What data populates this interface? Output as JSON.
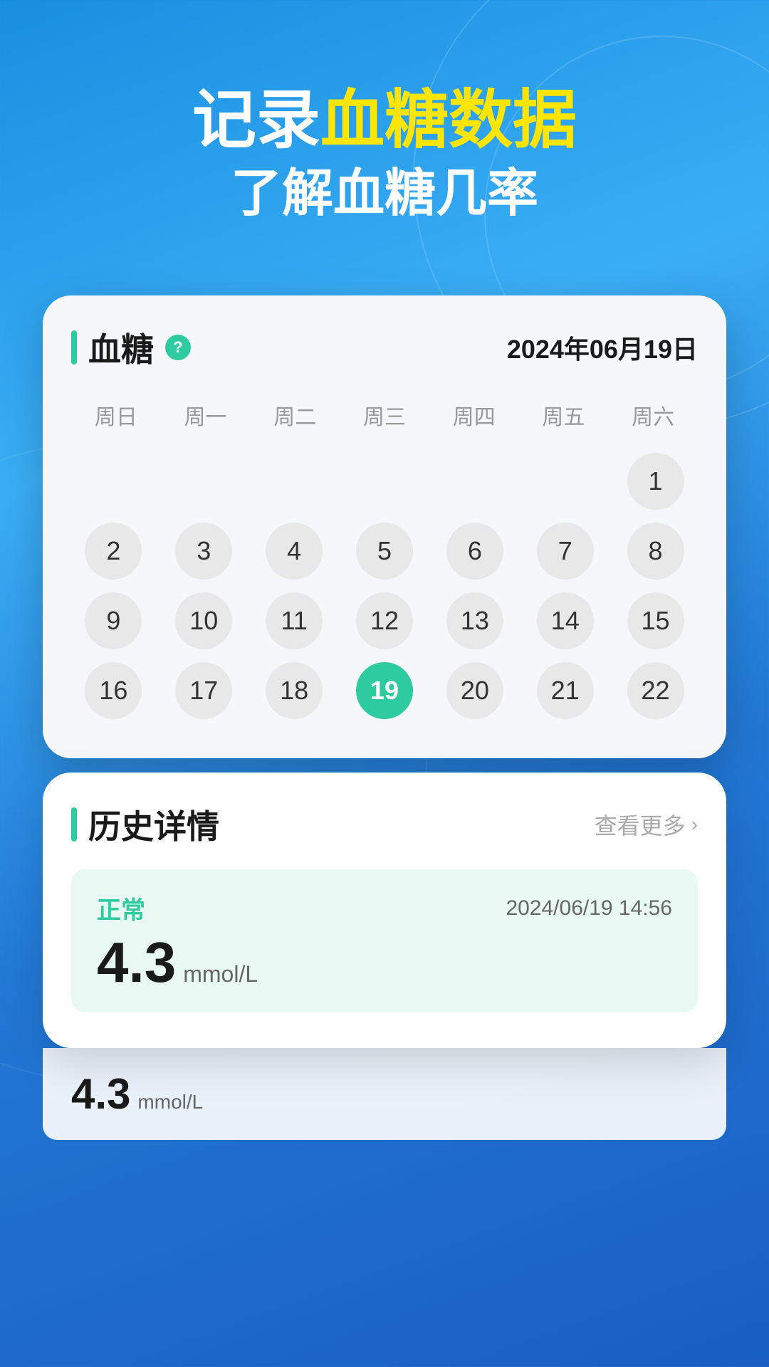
{
  "header": {
    "line1_prefix": "记录",
    "line1_highlight": "血糖数据",
    "line2": "了解血糖几率"
  },
  "calendar_card": {
    "title": "血糖",
    "date": "2024年06月19日",
    "help_icon": "?",
    "weekdays": [
      "周日",
      "周一",
      "周二",
      "周三",
      "周四",
      "周五",
      "周六"
    ],
    "days": [
      {
        "num": "",
        "empty": true
      },
      {
        "num": "",
        "empty": true
      },
      {
        "num": "",
        "empty": true
      },
      {
        "num": "",
        "empty": true
      },
      {
        "num": "",
        "empty": true
      },
      {
        "num": "",
        "empty": true
      },
      {
        "num": "1",
        "circle": true,
        "active": false
      },
      {
        "num": "2",
        "circle": true,
        "active": false
      },
      {
        "num": "3",
        "circle": true,
        "active": false
      },
      {
        "num": "4",
        "circle": true,
        "active": false
      },
      {
        "num": "5",
        "circle": true,
        "active": false
      },
      {
        "num": "6",
        "circle": true,
        "active": false
      },
      {
        "num": "7",
        "circle": true,
        "active": false
      },
      {
        "num": "8",
        "circle": true,
        "active": false
      },
      {
        "num": "9",
        "circle": true,
        "active": false
      },
      {
        "num": "10",
        "circle": true,
        "active": false
      },
      {
        "num": "11",
        "circle": true,
        "active": false
      },
      {
        "num": "12",
        "circle": true,
        "active": false
      },
      {
        "num": "13",
        "circle": true,
        "active": false
      },
      {
        "num": "14",
        "circle": true,
        "active": false
      },
      {
        "num": "15",
        "circle": true,
        "active": false
      },
      {
        "num": "16",
        "circle": true,
        "active": false
      },
      {
        "num": "17",
        "circle": true,
        "active": false
      },
      {
        "num": "18",
        "circle": true,
        "active": false
      },
      {
        "num": "19",
        "circle": true,
        "active": true
      },
      {
        "num": "20",
        "circle": true,
        "active": false
      },
      {
        "num": "21",
        "circle": true,
        "active": false
      },
      {
        "num": "22",
        "circle": true,
        "active": false
      }
    ]
  },
  "history_card": {
    "title": "历史详情",
    "view_more": "查看更多",
    "entry": {
      "status": "正常",
      "datetime": "2024/06/19 14:56",
      "value": "4.3",
      "unit": "mmol/L"
    }
  },
  "bottom_entry": {
    "value": "4.3",
    "unit": "mmol/L"
  },
  "colors": {
    "teal": "#2ECBA1",
    "yellow": "#FFE500",
    "bg_blue": "#2278d4"
  }
}
